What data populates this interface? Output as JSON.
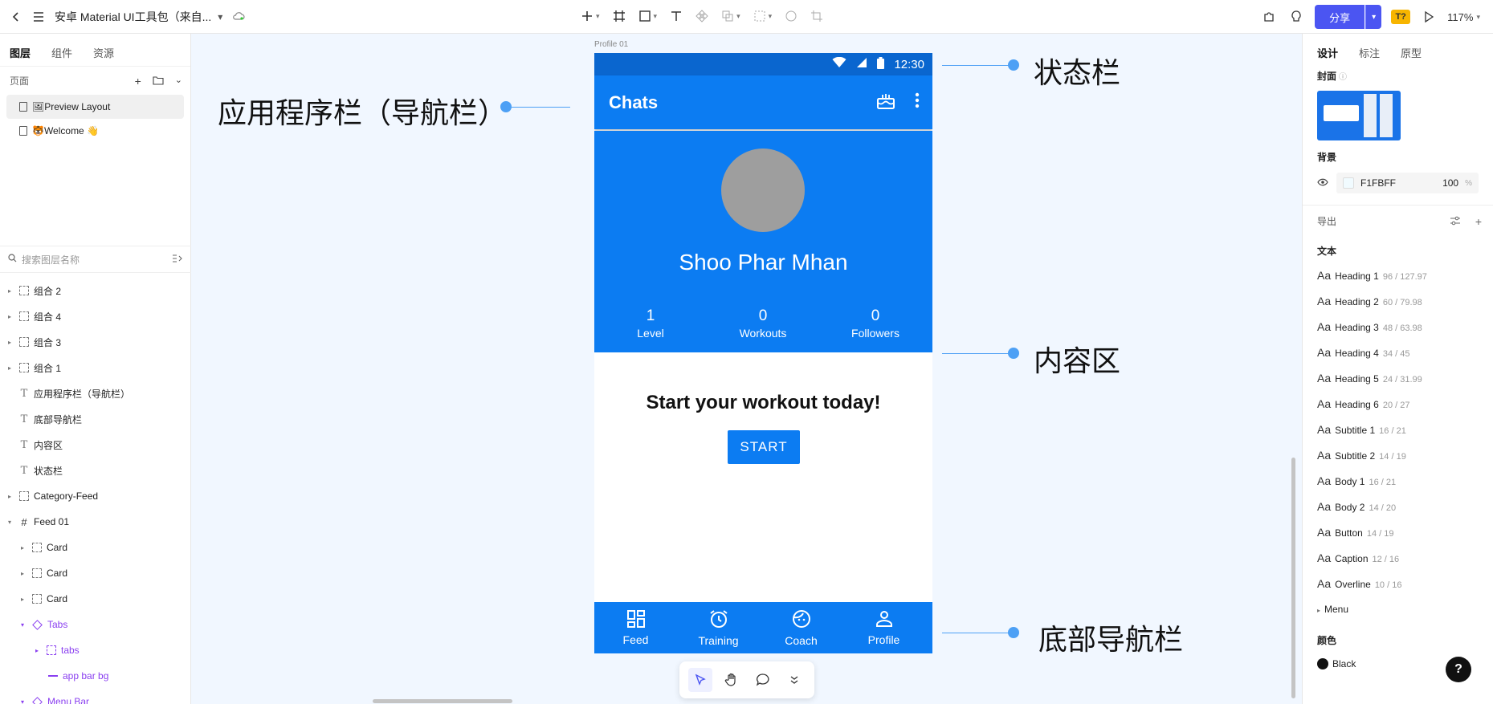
{
  "topbar": {
    "doc_title": "安卓 Material UI工具包（来自...",
    "share_label": "分享",
    "badge_label": "T?",
    "zoom": "117%"
  },
  "left_panel": {
    "tabs": [
      {
        "label": "图层"
      },
      {
        "label": "组件"
      },
      {
        "label": "资源"
      }
    ],
    "pages_label": "页面",
    "pages": [
      {
        "label": "🖼Preview Layout",
        "active": true
      },
      {
        "label": "🐯Welcome 👋",
        "active": false
      }
    ],
    "search_placeholder": "搜索图层名称",
    "layers": [
      {
        "label": "组合 2",
        "kind": "group"
      },
      {
        "label": "组合 4",
        "kind": "group"
      },
      {
        "label": "组合 3",
        "kind": "group"
      },
      {
        "label": "组合 1",
        "kind": "group"
      },
      {
        "label": "应用程序栏（导航栏）",
        "kind": "text"
      },
      {
        "label": "底部导航栏",
        "kind": "text"
      },
      {
        "label": "内容区",
        "kind": "text"
      },
      {
        "label": "状态栏",
        "kind": "text"
      },
      {
        "label": "Category-Feed",
        "kind": "group"
      },
      {
        "label": "Feed 01",
        "kind": "frame"
      },
      {
        "label": "Card",
        "kind": "group-child"
      },
      {
        "label": "Card",
        "kind": "group-child"
      },
      {
        "label": "Card",
        "kind": "group-child"
      },
      {
        "label": "Tabs",
        "kind": "component"
      },
      {
        "label": "tabs",
        "kind": "component-child"
      },
      {
        "label": "app bar bg",
        "kind": "line"
      },
      {
        "label": "Menu Bar",
        "kind": "component"
      }
    ]
  },
  "canvas": {
    "frame_label": "Profile 01",
    "status_time": "12:30",
    "appbar_title": "Chats",
    "profile_name": "Shoo Phar Mhan",
    "stats": [
      {
        "value": "1",
        "label": "Level"
      },
      {
        "value": "0",
        "label": "Workouts"
      },
      {
        "value": "0",
        "label": "Followers"
      }
    ],
    "cta_text": "Start your workout today!",
    "cta_button": "START",
    "bottom_nav": [
      {
        "label": "Feed",
        "icon": "dashboard-icon"
      },
      {
        "label": "Training",
        "icon": "alarm-icon"
      },
      {
        "label": "Coach",
        "icon": "face-icon"
      },
      {
        "label": "Profile",
        "icon": "person-icon"
      }
    ],
    "callouts": {
      "appbar": "应用程序栏（导航栏）",
      "statusbar": "状态栏",
      "content": "内容区",
      "bottomnav": "底部导航栏"
    }
  },
  "right_panel": {
    "tabs": [
      {
        "label": "设计"
      },
      {
        "label": "标注"
      },
      {
        "label": "原型"
      }
    ],
    "cover_label": "封面",
    "background_label": "背景",
    "bg_hex": "F1FBFF",
    "bg_opacity": "100",
    "bg_pct": "%",
    "export_label": "导出",
    "text_label": "文本",
    "text_styles": [
      {
        "aa": "Aa",
        "name": "Heading 1",
        "spec": "96 / 127.97"
      },
      {
        "aa": "Aa",
        "name": "Heading 2",
        "spec": "60 / 79.98"
      },
      {
        "aa": "Aa",
        "name": "Heading 3",
        "spec": "48 / 63.98"
      },
      {
        "aa": "Aa",
        "name": "Heading 4",
        "spec": "34 / 45"
      },
      {
        "aa": "Aa",
        "name": "Heading 5",
        "spec": "24 / 31.99"
      },
      {
        "aa": "Aa",
        "name": "Heading 6",
        "spec": "20 / 27"
      },
      {
        "aa": "Aa",
        "name": "Subtitle 1",
        "spec": "16 / 21"
      },
      {
        "aa": "Aa",
        "name": "Subtitle 2",
        "spec": "14 / 19"
      },
      {
        "aa": "Aa",
        "name": "Body 1",
        "spec": "16 / 21"
      },
      {
        "aa": "Aa",
        "name": "Body 2",
        "spec": "14 / 20"
      },
      {
        "aa": "Aa",
        "name": "Button",
        "spec": "14 / 19"
      },
      {
        "aa": "Aa",
        "name": "Caption",
        "spec": "12 / 16"
      },
      {
        "aa": "Aa",
        "name": "Overline",
        "spec": "10 / 16"
      }
    ],
    "menu_label": "Menu",
    "color_label": "颜色",
    "color_black": "Black",
    "help": "?"
  },
  "colors": {
    "brand": "#4b55f2",
    "app_blue": "#0c7cf2",
    "status_blue": "#0a66cf",
    "callout_line": "#4da0f5"
  }
}
